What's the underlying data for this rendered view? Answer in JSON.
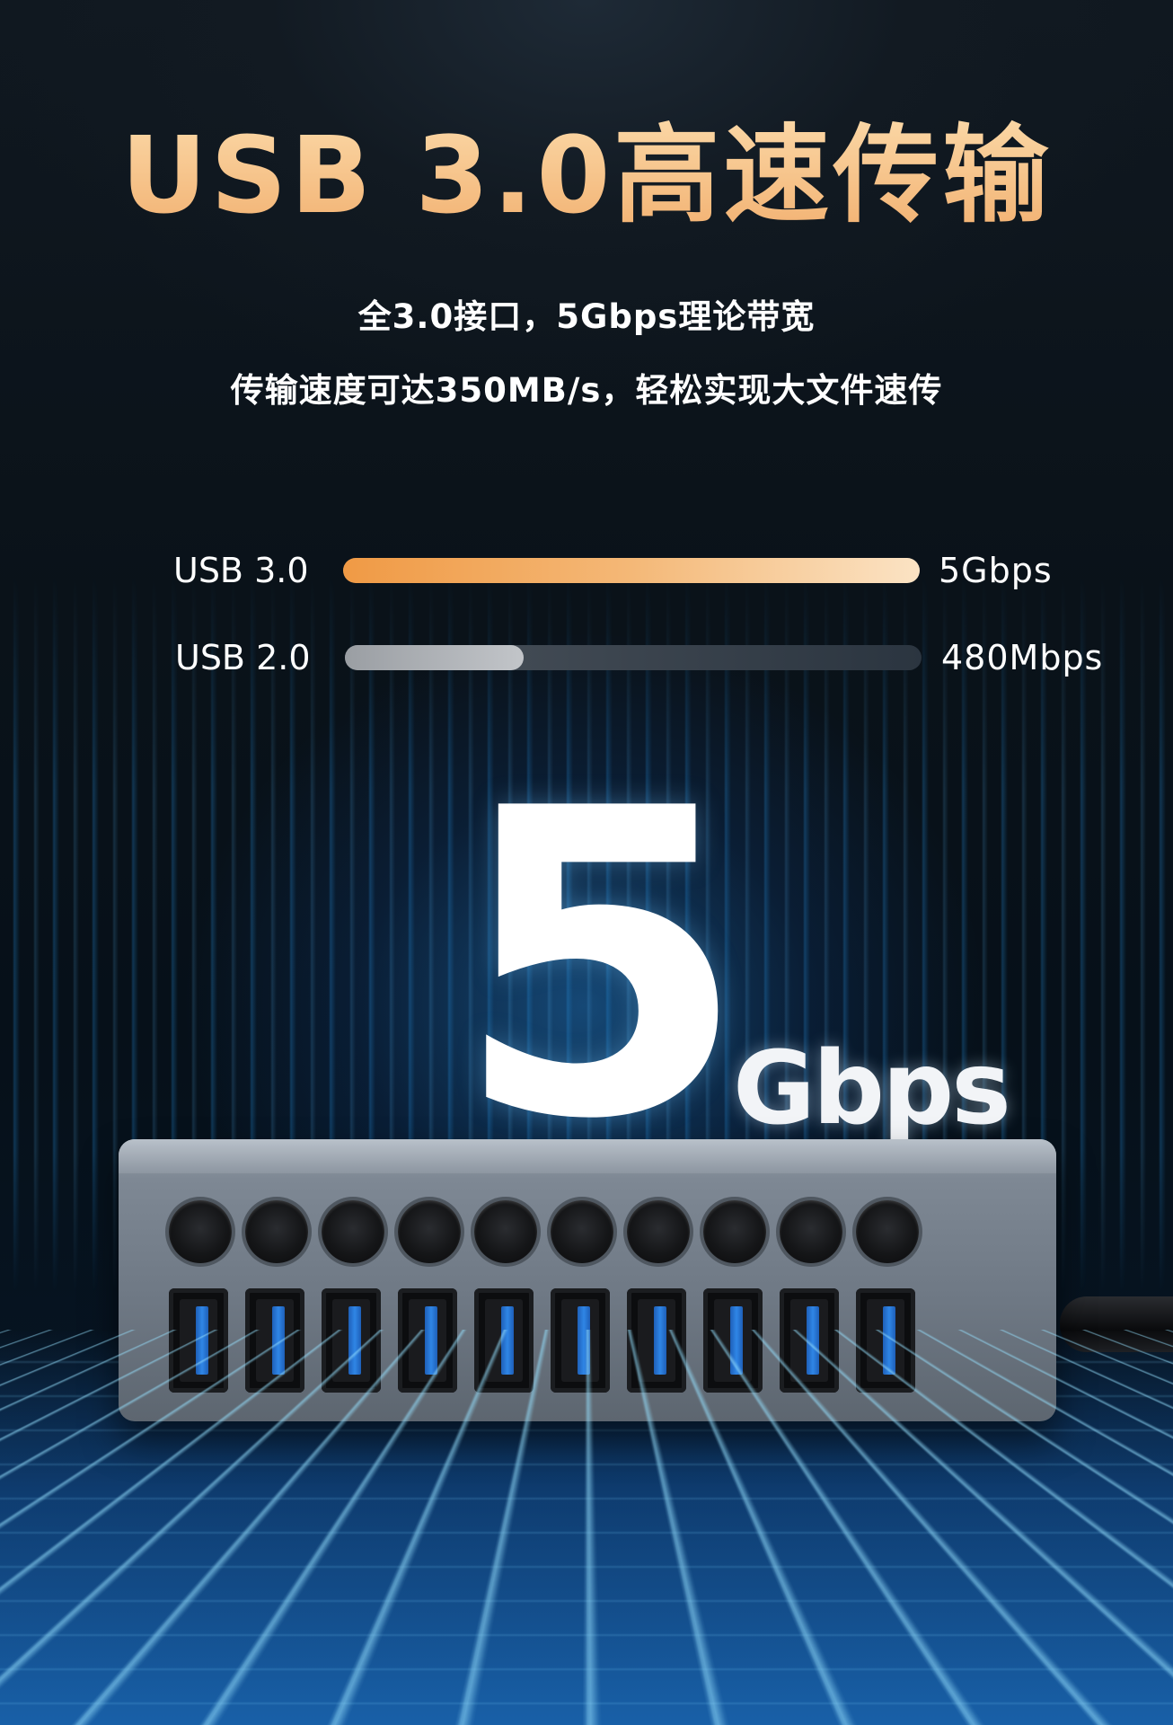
{
  "title": "USB 3.0高速传输",
  "subtitle_lines": [
    "全3.0接口，5Gbps理论带宽",
    "传输速度可达350MB/s，轻松实现大文件速传"
  ],
  "speed_compare": [
    {
      "label": "USB 3.0",
      "value_text": "5Gbps",
      "fill_fraction": 1.0,
      "color": "#f4a95a"
    },
    {
      "label": "USB 2.0",
      "value_text": "480Mbps",
      "fill_fraction": 0.31,
      "color": "#b8bbbf"
    }
  ],
  "hero": {
    "number": "5",
    "unit": "Gbps"
  },
  "product": {
    "buttons": 10,
    "ports": 10,
    "port_color": "#2f86e6"
  }
}
